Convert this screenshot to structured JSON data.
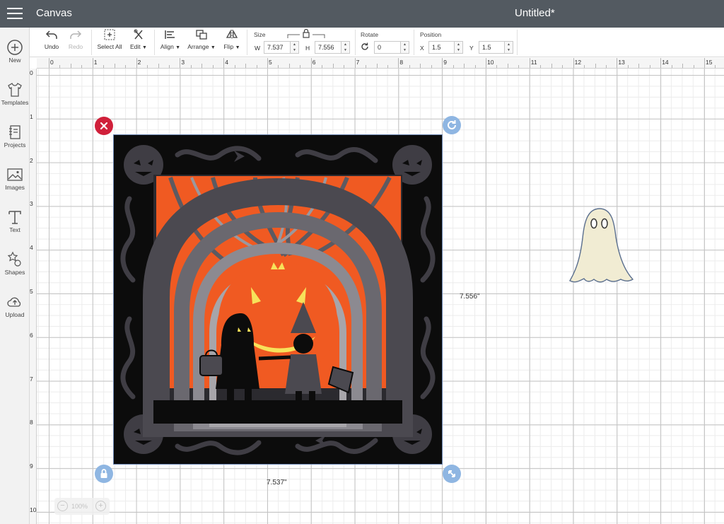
{
  "app": {
    "title": "Canvas",
    "document_title": "Untitled*"
  },
  "sidebar": {
    "items": [
      {
        "label": "New",
        "icon": "plus-circle-icon"
      },
      {
        "label": "Templates",
        "icon": "tshirt-icon"
      },
      {
        "label": "Projects",
        "icon": "notebook-icon"
      },
      {
        "label": "Images",
        "icon": "image-icon"
      },
      {
        "label": "Text",
        "icon": "text-t-icon"
      },
      {
        "label": "Shapes",
        "icon": "shapes-icon"
      },
      {
        "label": "Upload",
        "icon": "cloud-upload-icon"
      }
    ]
  },
  "toolbar": {
    "undo": "Undo",
    "redo": "Redo",
    "select_all": "Select All",
    "edit": "Edit",
    "align": "Align",
    "arrange": "Arrange",
    "flip": "Flip",
    "size_label": "Size",
    "w_letter": "W",
    "w_value": "7.537",
    "h_letter": "H",
    "h_value": "7.556",
    "rotate_label": "Rotate",
    "rotate_value": "0",
    "position_label": "Position",
    "x_letter": "X",
    "x_value": "1.5",
    "y_letter": "Y",
    "y_value": "1.5"
  },
  "rulers": {
    "top": [
      "0",
      "1",
      "2",
      "3",
      "4",
      "5",
      "6",
      "7",
      "8",
      "9",
      "10",
      "11",
      "12",
      "13",
      "14",
      "15"
    ],
    "left": [
      "0",
      "1",
      "2",
      "3",
      "4",
      "5",
      "6",
      "7",
      "8",
      "9",
      "10"
    ]
  },
  "canvas": {
    "width_label": "7.537\"",
    "height_label": "7.556\"",
    "zoom_value": "100%",
    "colors": {
      "orange": "#f05a22",
      "yellow": "#f7e25a",
      "ghost_fill": "#f1ecd3",
      "delete_red": "#d0203a",
      "handle_blue": "#8fb6e2"
    }
  }
}
